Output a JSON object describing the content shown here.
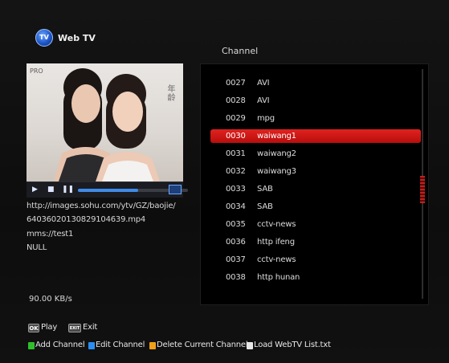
{
  "header": {
    "logo_text": "TV",
    "title": "Web TV",
    "channel_label": "Channel"
  },
  "player": {
    "preview_brand": "PRO",
    "preview_vertical_text": "年龄",
    "progress": 0.55,
    "url_line1": "http://images.sohu.com/ytv/GZ/baojie/",
    "url_line2": "64036020130829104639.mp4",
    "url_line3": "mms://test1",
    "url_line4": "NULL",
    "speed": "90.00 KB/s"
  },
  "channels": [
    {
      "num": "0027",
      "name": "AVI"
    },
    {
      "num": "0028",
      "name": "AVI"
    },
    {
      "num": "0029",
      "name": "mpg"
    },
    {
      "num": "0030",
      "name": "waiwang1",
      "selected": true
    },
    {
      "num": "0031",
      "name": "waiwang2"
    },
    {
      "num": "0032",
      "name": "waiwang3"
    },
    {
      "num": "0033",
      "name": "SAB"
    },
    {
      "num": "0034",
      "name": "SAB"
    },
    {
      "num": "0035",
      "name": "cctv-news"
    },
    {
      "num": "0036",
      "name": "http ifeng"
    },
    {
      "num": "0037",
      "name": "cctv-news"
    },
    {
      "num": "0038",
      "name": "http hunan"
    }
  ],
  "hints": {
    "ok_key": "OK",
    "play": "Play",
    "exit_key": "EXIT",
    "exit": "Exit",
    "add": "Add Channel",
    "edit": "Edit Channel",
    "delete": "Delete Current Channel",
    "load": "Load WebTV List.txt"
  },
  "colors": {
    "selection": "#d0181a",
    "green": "#2ec02a",
    "blue": "#2a8ef0",
    "yellow": "#f0a018",
    "white": "#e8e8e8"
  }
}
